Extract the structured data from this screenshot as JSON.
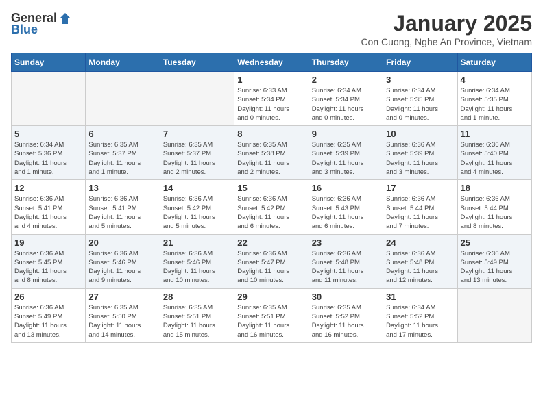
{
  "header": {
    "logo_general": "General",
    "logo_blue": "Blue",
    "month_title": "January 2025",
    "location": "Con Cuong, Nghe An Province, Vietnam"
  },
  "weekdays": [
    "Sunday",
    "Monday",
    "Tuesday",
    "Wednesday",
    "Thursday",
    "Friday",
    "Saturday"
  ],
  "weeks": [
    [
      {
        "day": "",
        "info": ""
      },
      {
        "day": "",
        "info": ""
      },
      {
        "day": "",
        "info": ""
      },
      {
        "day": "1",
        "info": "Sunrise: 6:33 AM\nSunset: 5:34 PM\nDaylight: 11 hours\nand 0 minutes."
      },
      {
        "day": "2",
        "info": "Sunrise: 6:34 AM\nSunset: 5:34 PM\nDaylight: 11 hours\nand 0 minutes."
      },
      {
        "day": "3",
        "info": "Sunrise: 6:34 AM\nSunset: 5:35 PM\nDaylight: 11 hours\nand 0 minutes."
      },
      {
        "day": "4",
        "info": "Sunrise: 6:34 AM\nSunset: 5:35 PM\nDaylight: 11 hours\nand 1 minute."
      }
    ],
    [
      {
        "day": "5",
        "info": "Sunrise: 6:34 AM\nSunset: 5:36 PM\nDaylight: 11 hours\nand 1 minute."
      },
      {
        "day": "6",
        "info": "Sunrise: 6:35 AM\nSunset: 5:37 PM\nDaylight: 11 hours\nand 1 minute."
      },
      {
        "day": "7",
        "info": "Sunrise: 6:35 AM\nSunset: 5:37 PM\nDaylight: 11 hours\nand 2 minutes."
      },
      {
        "day": "8",
        "info": "Sunrise: 6:35 AM\nSunset: 5:38 PM\nDaylight: 11 hours\nand 2 minutes."
      },
      {
        "day": "9",
        "info": "Sunrise: 6:35 AM\nSunset: 5:39 PM\nDaylight: 11 hours\nand 3 minutes."
      },
      {
        "day": "10",
        "info": "Sunrise: 6:36 AM\nSunset: 5:39 PM\nDaylight: 11 hours\nand 3 minutes."
      },
      {
        "day": "11",
        "info": "Sunrise: 6:36 AM\nSunset: 5:40 PM\nDaylight: 11 hours\nand 4 minutes."
      }
    ],
    [
      {
        "day": "12",
        "info": "Sunrise: 6:36 AM\nSunset: 5:41 PM\nDaylight: 11 hours\nand 4 minutes."
      },
      {
        "day": "13",
        "info": "Sunrise: 6:36 AM\nSunset: 5:41 PM\nDaylight: 11 hours\nand 5 minutes."
      },
      {
        "day": "14",
        "info": "Sunrise: 6:36 AM\nSunset: 5:42 PM\nDaylight: 11 hours\nand 5 minutes."
      },
      {
        "day": "15",
        "info": "Sunrise: 6:36 AM\nSunset: 5:42 PM\nDaylight: 11 hours\nand 6 minutes."
      },
      {
        "day": "16",
        "info": "Sunrise: 6:36 AM\nSunset: 5:43 PM\nDaylight: 11 hours\nand 6 minutes."
      },
      {
        "day": "17",
        "info": "Sunrise: 6:36 AM\nSunset: 5:44 PM\nDaylight: 11 hours\nand 7 minutes."
      },
      {
        "day": "18",
        "info": "Sunrise: 6:36 AM\nSunset: 5:44 PM\nDaylight: 11 hours\nand 8 minutes."
      }
    ],
    [
      {
        "day": "19",
        "info": "Sunrise: 6:36 AM\nSunset: 5:45 PM\nDaylight: 11 hours\nand 8 minutes."
      },
      {
        "day": "20",
        "info": "Sunrise: 6:36 AM\nSunset: 5:46 PM\nDaylight: 11 hours\nand 9 minutes."
      },
      {
        "day": "21",
        "info": "Sunrise: 6:36 AM\nSunset: 5:46 PM\nDaylight: 11 hours\nand 10 minutes."
      },
      {
        "day": "22",
        "info": "Sunrise: 6:36 AM\nSunset: 5:47 PM\nDaylight: 11 hours\nand 10 minutes."
      },
      {
        "day": "23",
        "info": "Sunrise: 6:36 AM\nSunset: 5:48 PM\nDaylight: 11 hours\nand 11 minutes."
      },
      {
        "day": "24",
        "info": "Sunrise: 6:36 AM\nSunset: 5:48 PM\nDaylight: 11 hours\nand 12 minutes."
      },
      {
        "day": "25",
        "info": "Sunrise: 6:36 AM\nSunset: 5:49 PM\nDaylight: 11 hours\nand 13 minutes."
      }
    ],
    [
      {
        "day": "26",
        "info": "Sunrise: 6:36 AM\nSunset: 5:49 PM\nDaylight: 11 hours\nand 13 minutes."
      },
      {
        "day": "27",
        "info": "Sunrise: 6:35 AM\nSunset: 5:50 PM\nDaylight: 11 hours\nand 14 minutes."
      },
      {
        "day": "28",
        "info": "Sunrise: 6:35 AM\nSunset: 5:51 PM\nDaylight: 11 hours\nand 15 minutes."
      },
      {
        "day": "29",
        "info": "Sunrise: 6:35 AM\nSunset: 5:51 PM\nDaylight: 11 hours\nand 16 minutes."
      },
      {
        "day": "30",
        "info": "Sunrise: 6:35 AM\nSunset: 5:52 PM\nDaylight: 11 hours\nand 16 minutes."
      },
      {
        "day": "31",
        "info": "Sunrise: 6:34 AM\nSunset: 5:52 PM\nDaylight: 11 hours\nand 17 minutes."
      },
      {
        "day": "",
        "info": ""
      }
    ]
  ]
}
